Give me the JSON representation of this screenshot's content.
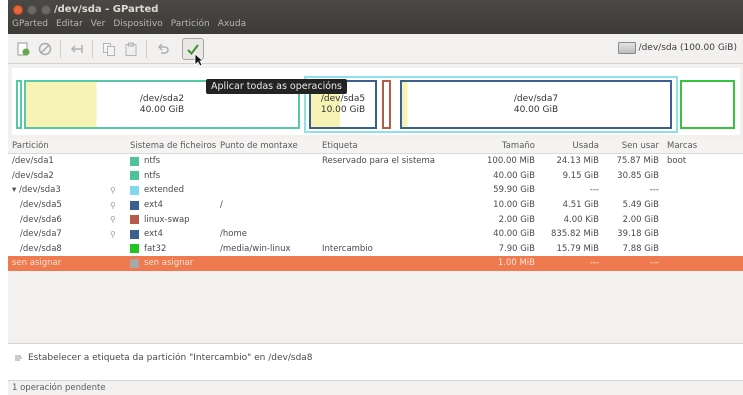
{
  "window": {
    "title": "/dev/sda - GParted",
    "menu": [
      "GParted",
      "Editar",
      "Ver",
      "Dispositivo",
      "Partición",
      "Axuda"
    ]
  },
  "toolbar": {
    "icons": [
      "new-icon",
      "delete-icon",
      "resize-icon",
      "copy-icon",
      "paste-icon",
      "undo-icon",
      "apply-icon"
    ],
    "apply_tooltip": "Aplicar todas as operacións",
    "device": "/dev/sda  (100.00 GiB)"
  },
  "map": {
    "sda2": {
      "name": "/dev/sda2",
      "size": "40.00 GiB"
    },
    "sda5": {
      "name": "/dev/sda5",
      "size": "10.00 GiB"
    },
    "sda7": {
      "name": "/dev/sda7",
      "size": "40.00 GiB"
    }
  },
  "table": {
    "headers": {
      "partition": "Partición",
      "filesystem": "Sistema de ficheiros",
      "mount": "Punto de montaxe",
      "label": "Etiqueta",
      "size": "Tamaño",
      "used": "Usada",
      "unused": "Sen usar",
      "flags": "Marcas"
    },
    "rows": [
      {
        "partition": "/dev/sda1",
        "lock": "",
        "color": "#4dc39c",
        "fs": "ntfs",
        "mount": "",
        "label": "Reservado para el sistema",
        "size": "100.00 MiB",
        "used": "24.13 MiB",
        "unused": "75.87 MiB",
        "flags": "boot"
      },
      {
        "partition": "/dev/sda2",
        "lock": "",
        "color": "#4dc39c",
        "fs": "ntfs",
        "mount": "",
        "label": "",
        "size": "40.00 GiB",
        "used": "9.15 GiB",
        "unused": "30.85 GiB",
        "flags": ""
      },
      {
        "partition": "/dev/sda3",
        "lock": "key",
        "color": "#7fdbec",
        "fs": "extended",
        "mount": "",
        "label": "",
        "size": "59.90 GiB",
        "used": "---",
        "unused": "---",
        "flags": ""
      },
      {
        "partition": "/dev/sda5",
        "lock": "key",
        "color": "#3b5f8e",
        "fs": "ext4",
        "mount": "/",
        "label": "",
        "size": "10.00 GiB",
        "used": "4.51 GiB",
        "unused": "5.49 GiB",
        "flags": ""
      },
      {
        "partition": "/dev/sda6",
        "lock": "key",
        "color": "#b85a4b",
        "fs": "linux-swap",
        "mount": "",
        "label": "",
        "size": "2.00 GiB",
        "used": "4.00 KiB",
        "unused": "2.00 GiB",
        "flags": ""
      },
      {
        "partition": "/dev/sda7",
        "lock": "key",
        "color": "#3b5f8e",
        "fs": "ext4",
        "mount": "/home",
        "label": "",
        "size": "40.00 GiB",
        "used": "835.82 MiB",
        "unused": "39.18 GiB",
        "flags": ""
      },
      {
        "partition": "/dev/sda8",
        "lock": "",
        "color": "#22c522",
        "fs": "fat32",
        "mount": "/media/win-linux",
        "label": "Intercambio",
        "size": "7.90 GiB",
        "used": "15.79 MiB",
        "unused": "7.88 GiB",
        "flags": ""
      },
      {
        "partition": "sen asignar",
        "lock": "",
        "color": "#a8a8a8",
        "fs": "sen asignar",
        "mount": "",
        "label": "",
        "size": "1.00 MiB",
        "used": "---",
        "unused": "---",
        "flags": ""
      }
    ]
  },
  "operations": {
    "items": [
      "Estabelecer a etiqueta da partición \"Intercambio\" en /dev/sda8"
    ]
  },
  "status": "1 operación pendente"
}
